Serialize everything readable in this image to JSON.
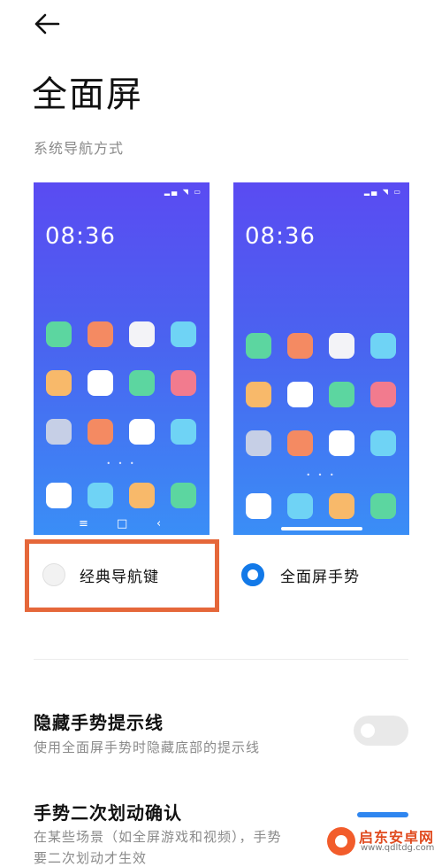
{
  "header": {
    "back_icon": "arrow-left-icon",
    "title": "全面屏"
  },
  "section": {
    "label": "系统导航方式"
  },
  "phone_preview": {
    "clock": "08:36",
    "page_dots": "• • •"
  },
  "options": {
    "classic": {
      "label": "经典导航键",
      "selected": false,
      "nav_keys": [
        "≡",
        "□",
        "‹"
      ]
    },
    "gesture": {
      "label": "全面屏手势",
      "selected": true
    }
  },
  "settings": {
    "hide_hint": {
      "title": "隐藏手势提示线",
      "description": "使用全面屏手势时隐藏底部的提示线",
      "enabled": false
    },
    "double_swipe": {
      "title": "手势二次划动确认",
      "description_line1": "在某些场景（如全屏游戏和视频），手势",
      "description_line2": "要二次划动才生效"
    }
  },
  "watermark": {
    "text": "启东安卓网",
    "url": "www.qdltdg.com"
  },
  "colors": {
    "accent": "#1279e8",
    "highlight": "#e5673a",
    "wallpaper_top": "#5a4bf2",
    "wallpaper_bottom": "#3a8ef6"
  }
}
